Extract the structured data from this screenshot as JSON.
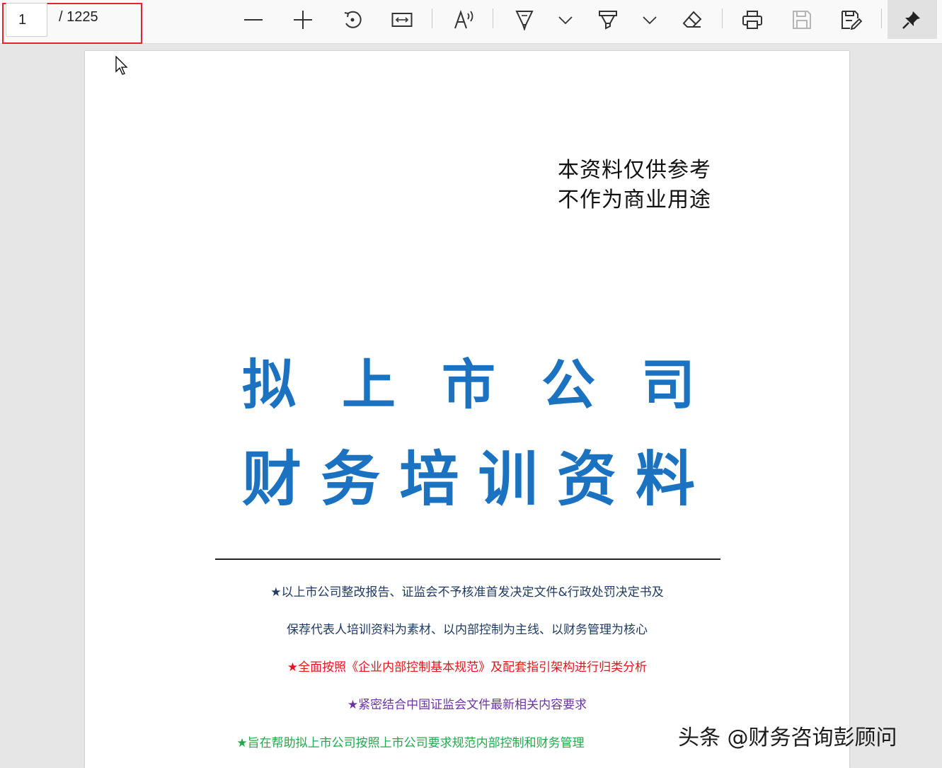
{
  "toolbar": {
    "page_current": "1",
    "page_total": "/ 1225",
    "icons": [
      "zoom-out-icon",
      "zoom-in-icon",
      "rotate-icon",
      "fit-width-icon",
      "read-aloud-icon",
      "draw-icon",
      "chevron-down-icon",
      "highlight-icon",
      "chevron-down-icon",
      "eraser-icon",
      "print-icon",
      "save-icon",
      "save-as-icon",
      "pin-icon"
    ],
    "highlight_color": "#e8232b"
  },
  "document": {
    "note_line1": "本资料仅供参考",
    "note_line2": "不作为商业用途",
    "title_line1": [
      "拟",
      "上",
      "市",
      "公",
      "司"
    ],
    "title_line2": [
      "财",
      "务",
      "培",
      "训",
      "资",
      "料"
    ],
    "title_color": "#1b72c0",
    "bullets": [
      "★以上市公司整改报告、证监会不予核准首发决定文件&行政处罚决定书及",
      "保荐代表人培训资料为素材、以内部控制为主线、以财务管理为核心",
      "★全面按照《企业内部控制基本规范》及配套指引架构进行归类分析",
      "★紧密结合中国证监会文件最新相关内容要求",
      "★旨在帮助拟上市公司按照上市公司要求规范内部控制和财务管理"
    ]
  },
  "watermark": "头条 @财务咨询彭顾问"
}
